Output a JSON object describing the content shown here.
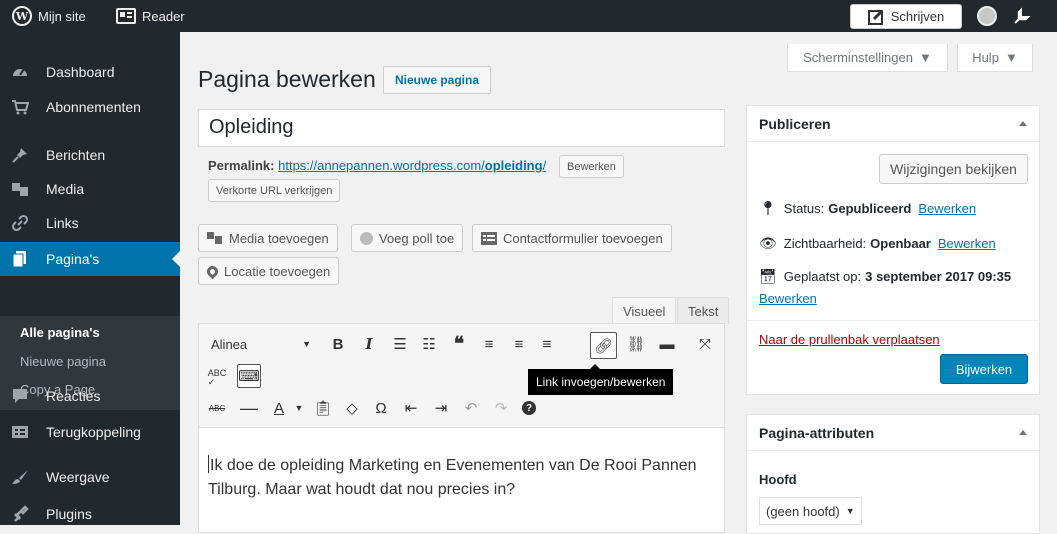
{
  "topbar": {
    "site_label": "Mijn site",
    "reader_label": "Reader",
    "write_label": "Schrijven",
    "icons": [
      "wordpress-icon",
      "reader-icon",
      "write-icon",
      "avatar",
      "notification-icon"
    ]
  },
  "sidebar": {
    "items": [
      {
        "label": "Dashboard",
        "icon": "dashboard-icon"
      },
      {
        "label": "Abonnementen",
        "icon": "cart-icon"
      },
      {
        "label": "Berichten",
        "icon": "pin-icon"
      },
      {
        "label": "Media",
        "icon": "media-icon"
      },
      {
        "label": "Links",
        "icon": "link-icon"
      },
      {
        "label": "Pagina's",
        "icon": "pages-icon"
      },
      {
        "label": "Reacties",
        "icon": "comment-icon"
      },
      {
        "label": "Terugkoppeling",
        "icon": "feedback-icon"
      },
      {
        "label": "Weergave",
        "icon": "appearance-icon"
      },
      {
        "label": "Plugins",
        "icon": "plugins-icon"
      }
    ],
    "submenu": [
      "Alle pagina's",
      "Nieuwe pagina",
      "Copy a Page"
    ]
  },
  "screen_options": {
    "screen_label": "Scherminstellingen",
    "help_label": "Hulp"
  },
  "header": {
    "title": "Pagina bewerken",
    "add_new": "Nieuwe pagina"
  },
  "post": {
    "title": "Opleiding",
    "permalink_label": "Permalink:",
    "permalink_base": "https://annepannen.wordpress.com/",
    "permalink_slug": "opleiding",
    "permalink_end": "/",
    "edit_label": "Bewerken",
    "shortlink_label": "Verkorte URL verkrijgen"
  },
  "media_buttons": {
    "add_media": "Media toevoegen",
    "add_poll": "Voeg poll toe",
    "contact_form": "Contactformulier toevoegen",
    "location": "Locatie toevoegen"
  },
  "editor": {
    "tabs": {
      "visual": "Visueel",
      "text": "Tekst"
    },
    "format_select": "Alinea",
    "tooltip": "Link invoegen/bewerken",
    "content": "Ik doe de opleiding Marketing en Evenementen van De Rooi Pannen Tilburg. Maar wat houdt dat nou precies in?"
  },
  "publish": {
    "title": "Publiceren",
    "preview_label": "Wijzigingen bekijken",
    "status_label": "Status:",
    "status_value": "Gepubliceerd",
    "status_edit": "Bewerken",
    "visibility_label": "Zichtbaarheid:",
    "visibility_value": "Openbaar",
    "visibility_edit": "Bewerken",
    "published_label": "Geplaatst op:",
    "published_value": "3 september 2017 09:35",
    "published_edit": "Bewerken",
    "trash_label": "Naar de prullenbak verplaatsen",
    "update_label": "Bijwerken"
  },
  "attributes": {
    "title": "Pagina-attributen",
    "parent_label": "Hoofd",
    "parent_value": "(geen hoofd)"
  },
  "colors": {
    "admin_dark": "#23282d",
    "accent": "#0073aa",
    "primary_button": "#0085ba",
    "trash": "#a00"
  }
}
